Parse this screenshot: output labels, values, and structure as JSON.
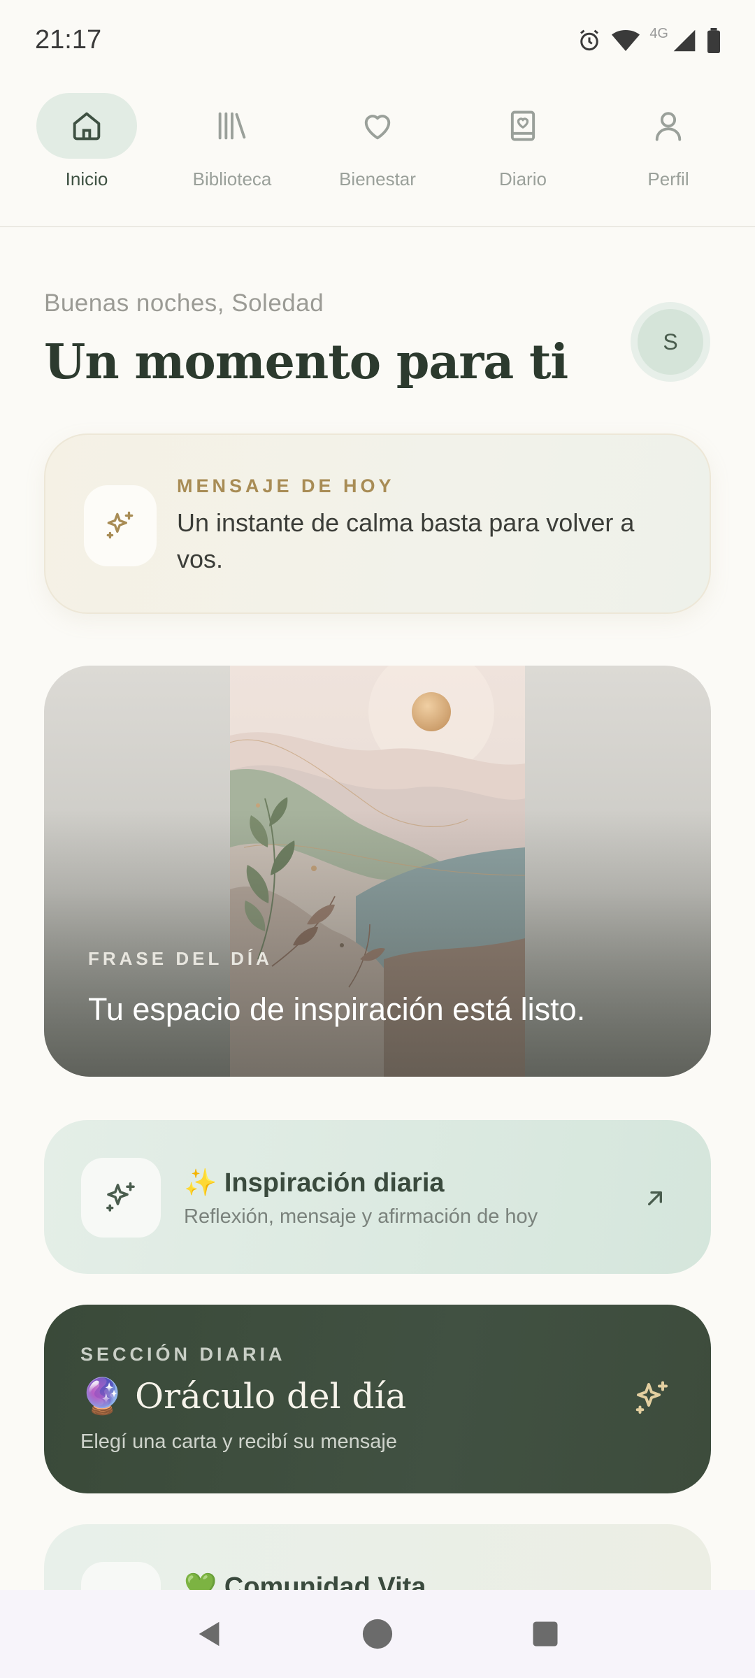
{
  "status_bar": {
    "time": "21:17",
    "network": "4G",
    "icons": [
      "alarm-icon",
      "wifi-icon",
      "signal-icon",
      "battery-icon"
    ]
  },
  "nav": {
    "items": [
      {
        "label": "Inicio",
        "icon": "home-icon",
        "active": true
      },
      {
        "label": "Biblioteca",
        "icon": "library-icon",
        "active": false
      },
      {
        "label": "Bienestar",
        "icon": "heart-icon",
        "active": false
      },
      {
        "label": "Diario",
        "icon": "journal-icon",
        "active": false
      },
      {
        "label": "Perfil",
        "icon": "user-icon",
        "active": false
      }
    ]
  },
  "header": {
    "greeting": "Buenas noches, Soledad",
    "title": "Un momento para ti",
    "avatar_initial": "S"
  },
  "message_card": {
    "kicker": "MENSAJE DE HOY",
    "text": "Un instante de calma basta para volver a vos."
  },
  "quote_card": {
    "kicker": "FRASE DEL DÍA",
    "text": "Tu espacio de inspiración está listo."
  },
  "inspiration_card": {
    "title": "✨ Inspiración diaria",
    "subtitle": "Reflexión, mensaje y afirmación de hoy"
  },
  "oracle_card": {
    "kicker": "SECCIÓN DIARIA",
    "title": "🔮 Oráculo del día",
    "subtitle": "Elegí una carta y recibí su mensaje"
  },
  "community_card": {
    "title": "💚 Comunidad Vita"
  },
  "colors": {
    "background": "#fbfaf6",
    "accent_green": "#3e5142",
    "gold": "#a88c55",
    "dark_card": "#3a4a39"
  }
}
